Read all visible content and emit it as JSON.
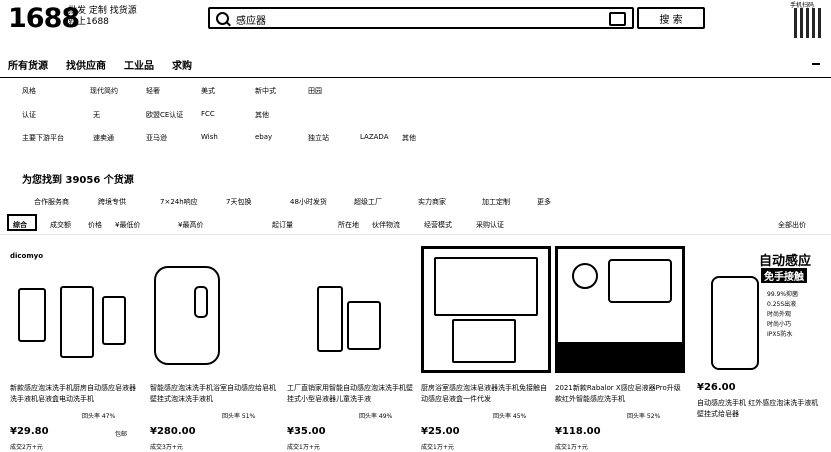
{
  "header": {
    "logo": "1688",
    "slogan": "批发 定制 找货源 就上1688",
    "search_value": "感应器",
    "search_button": "搜 索",
    "app_label": "手机扫码"
  },
  "nav": [
    "所有货源",
    "找供应商",
    "工业品",
    "求购"
  ],
  "filters": [
    {
      "label": "风格",
      "options": [
        "现代简约",
        "轻奢",
        "美式",
        "新中式",
        "田园"
      ]
    },
    {
      "label": "认证",
      "options": [
        "无",
        "欧盟CE认证",
        "FCC",
        "其他"
      ]
    },
    {
      "label": "主要下游平台",
      "options": [
        "速卖通",
        "亚马逊",
        "Wish",
        "ebay",
        "独立站",
        "LAZADA",
        "其他"
      ]
    }
  ],
  "result_summary": "为您找到 39056 个货源",
  "service_filters": [
    "合作服务商",
    "跨境专供",
    "7×24h响应",
    "7天包换",
    "48小时发货",
    "超级工厂",
    "实力商家",
    "加工定制",
    "更多"
  ],
  "sort_options": [
    "综合",
    "成交额",
    "价格",
    "¥最低价",
    "¥最高价",
    "起订量",
    "所在地",
    "伙伴物流",
    "经营模式",
    "采购认证",
    "全部出价"
  ],
  "brand_tag": "dicomyo",
  "products": [
    {
      "title": "新款感应泡沫洗手机厨房自动感应皂液器 洗手液机皂液盒电动洗手机",
      "meta": "回头率 47%",
      "price": "¥29.80",
      "sold": "成交2万+元",
      "shipping": "包邮"
    },
    {
      "title": "智能感应泡沫洗手机浴室自动感应给皂机 壁挂式泡沫洗手液机",
      "meta": "回头率 51%",
      "price": "¥280.00",
      "sold": "成交3万+元",
      "shipping": ""
    },
    {
      "title": "工厂直销家用智能自动感应泡沫洗手机壁挂式小型皂液器儿童洗手液",
      "meta": "回头率 49%",
      "price": "¥35.00",
      "sold": "成交1万+元",
      "shipping": ""
    },
    {
      "title": "厨房浴室感应泡沫皂液器洗手机免接触自动感应皂液盒一件代发",
      "meta": "回头率 45%",
      "price": "¥25.00",
      "sold": "成交1万+元",
      "shipping": ""
    },
    {
      "title": "2021新款Rabalor X感应皂液器Pro升级款红外智能感应洗手机",
      "meta": "回头率 52%",
      "price": "¥118.00",
      "sold": "成交1万+元",
      "shipping": ""
    },
    {
      "title": "自动感应洗手机 红外感应泡沫洗手液机 壁挂式给皂器",
      "meta": "",
      "price": "¥26.00",
      "sold": "",
      "shipping": "",
      "badge": "自动感应",
      "badge2": "免手接触",
      "bullets": [
        "99.9%抑菌",
        "0.25S出液",
        "时尚外观",
        "时尚小巧",
        "IPX5防水"
      ]
    }
  ]
}
